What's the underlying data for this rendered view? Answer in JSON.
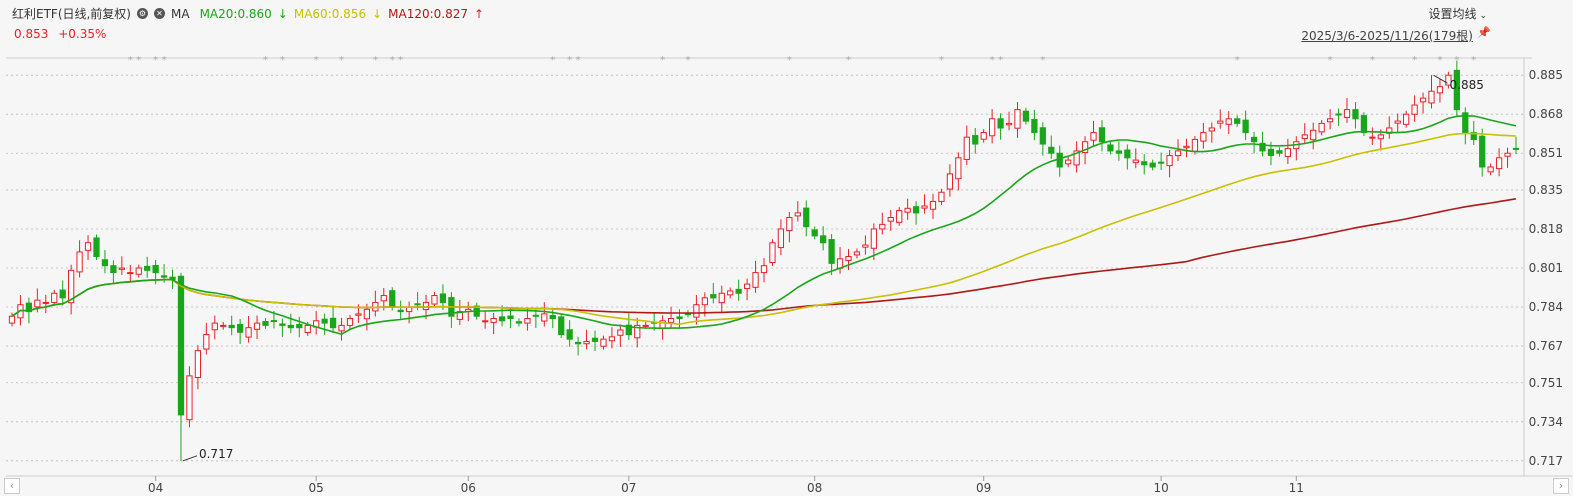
{
  "header": {
    "title": "红利ETF(日线,前复权)",
    "gear_icon": "gear-icon",
    "close_icon": "close-icon",
    "ma_label": "MA",
    "ma20": "MA20:0.860",
    "ma20_arrow": "↓",
    "ma60": "MA60:0.856",
    "ma60_arrow": "↓",
    "ma120": "MA120:0.827",
    "ma120_arrow": "↑",
    "price": "0.853",
    "change": "+0.35%",
    "settings_label": "设置均线",
    "range_label": "2025/3/6-2025/11/26(179根)"
  },
  "colors": {
    "up": "#e8202a",
    "down": "#1aa61a",
    "ma20": "#1aa61a",
    "ma60": "#c8c000",
    "ma120": "#b01818",
    "grid": "#bbbbbb",
    "background": "#f6f6f6"
  },
  "chart_data": {
    "type": "candlestick",
    "y_ticks": [
      "0.885",
      "0.868",
      "0.851",
      "0.835",
      "0.818",
      "0.801",
      "0.784",
      "0.767",
      "0.751",
      "0.734",
      "0.717"
    ],
    "ylim": [
      0.713,
      0.889
    ],
    "x_ticks": [
      {
        "label": "04",
        "index": 17
      },
      {
        "label": "05",
        "index": 36
      },
      {
        "label": "06",
        "index": 54
      },
      {
        "label": "07",
        "index": 73
      },
      {
        "label": "08",
        "index": 95
      },
      {
        "label": "09",
        "index": 115
      },
      {
        "label": "10",
        "index": 136
      },
      {
        "label": "11",
        "index": 152
      }
    ],
    "candle_count": 179,
    "close": [
      0.78,
      0.785,
      0.782,
      0.787,
      0.786,
      0.79,
      0.788,
      0.8,
      0.808,
      0.812,
      0.806,
      0.802,
      0.799,
      0.801,
      0.799,
      0.801,
      0.8,
      0.799,
      0.797,
      0.796,
      0.737,
      0.754,
      0.765,
      0.772,
      0.777,
      0.776,
      0.775,
      0.773,
      0.775,
      0.777,
      0.776,
      0.778,
      0.776,
      0.775,
      0.775,
      0.776,
      0.778,
      0.777,
      0.775,
      0.776,
      0.779,
      0.781,
      0.783,
      0.786,
      0.789,
      0.784,
      0.782,
      0.784,
      0.785,
      0.786,
      0.789,
      0.786,
      0.78,
      0.782,
      0.783,
      0.78,
      0.778,
      0.779,
      0.778,
      0.779,
      0.777,
      0.779,
      0.78,
      0.781,
      0.779,
      0.772,
      0.77,
      0.768,
      0.769,
      0.769,
      0.77,
      0.771,
      0.774,
      0.772,
      0.776,
      0.776,
      0.777,
      0.778,
      0.779,
      0.779,
      0.781,
      0.785,
      0.788,
      0.788,
      0.79,
      0.791,
      0.79,
      0.794,
      0.799,
      0.802,
      0.812,
      0.818,
      0.823,
      0.825,
      0.819,
      0.815,
      0.812,
      0.803,
      0.805,
      0.806,
      0.808,
      0.811,
      0.818,
      0.82,
      0.823,
      0.826,
      0.827,
      0.825,
      0.828,
      0.83,
      0.834,
      0.842,
      0.849,
      0.858,
      0.855,
      0.86,
      0.866,
      0.862,
      0.864,
      0.87,
      0.865,
      0.86,
      0.855,
      0.851,
      0.845,
      0.848,
      0.852,
      0.856,
      0.86,
      0.856,
      0.852,
      0.851,
      0.849,
      0.848,
      0.846,
      0.845,
      0.847,
      0.85,
      0.852,
      0.854,
      0.857,
      0.86,
      0.862,
      0.865,
      0.866,
      0.864,
      0.86,
      0.856,
      0.852,
      0.85,
      0.851,
      0.853,
      0.856,
      0.859,
      0.861,
      0.864,
      0.866,
      0.868,
      0.87,
      0.866,
      0.86,
      0.858,
      0.859,
      0.862,
      0.865,
      0.868,
      0.872,
      0.875,
      0.878,
      0.88,
      0.885,
      0.87,
      0.86,
      0.857,
      0.845,
      0.845,
      0.849,
      0.851,
      0.853
    ],
    "high_label": "0.885",
    "low_label": "0.717",
    "ma20": {
      "name": "MA20",
      "last": 0.86
    },
    "ma60": {
      "name": "MA60",
      "last": 0.856
    },
    "ma120": {
      "name": "MA120",
      "last": 0.827
    },
    "grid": true,
    "legend": "top-left"
  }
}
